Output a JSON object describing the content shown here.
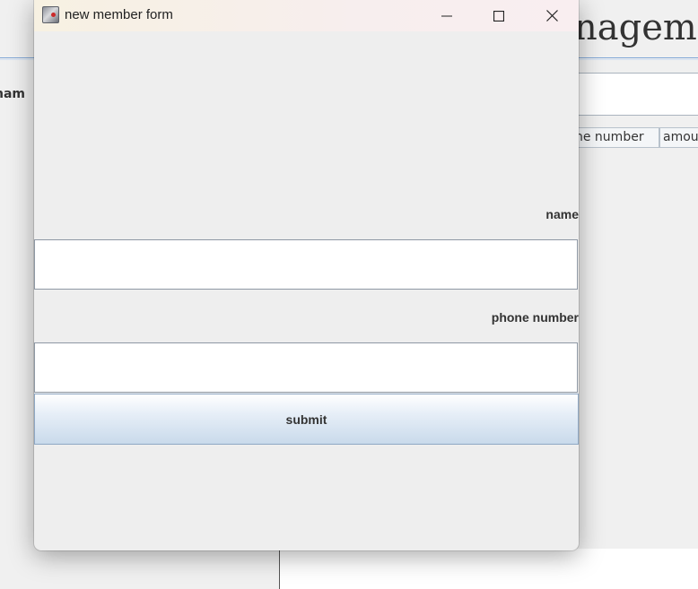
{
  "background_window": {
    "title_fragment": "nageme",
    "name_label_fragment": "nam",
    "table_headers": [
      "ne number",
      "amoun"
    ]
  },
  "dialog": {
    "title": "new member form",
    "window_controls": {
      "minimize_icon": "minimize-icon",
      "maximize_icon": "maximize-icon",
      "close_icon": "close-icon"
    },
    "fields": {
      "name": {
        "label": "name",
        "value": "",
        "placeholder": ""
      },
      "phone": {
        "label": "phone number",
        "value": "",
        "placeholder": ""
      }
    },
    "submit_label": "submit"
  },
  "colors": {
    "dialog_bg": "#eeeeee",
    "titlebar_bg": "#f8f0ea",
    "button_gradient_top": "#ffffff",
    "button_gradient_bottom": "#c9daeb",
    "accent_rule": "#7fa6d6"
  }
}
